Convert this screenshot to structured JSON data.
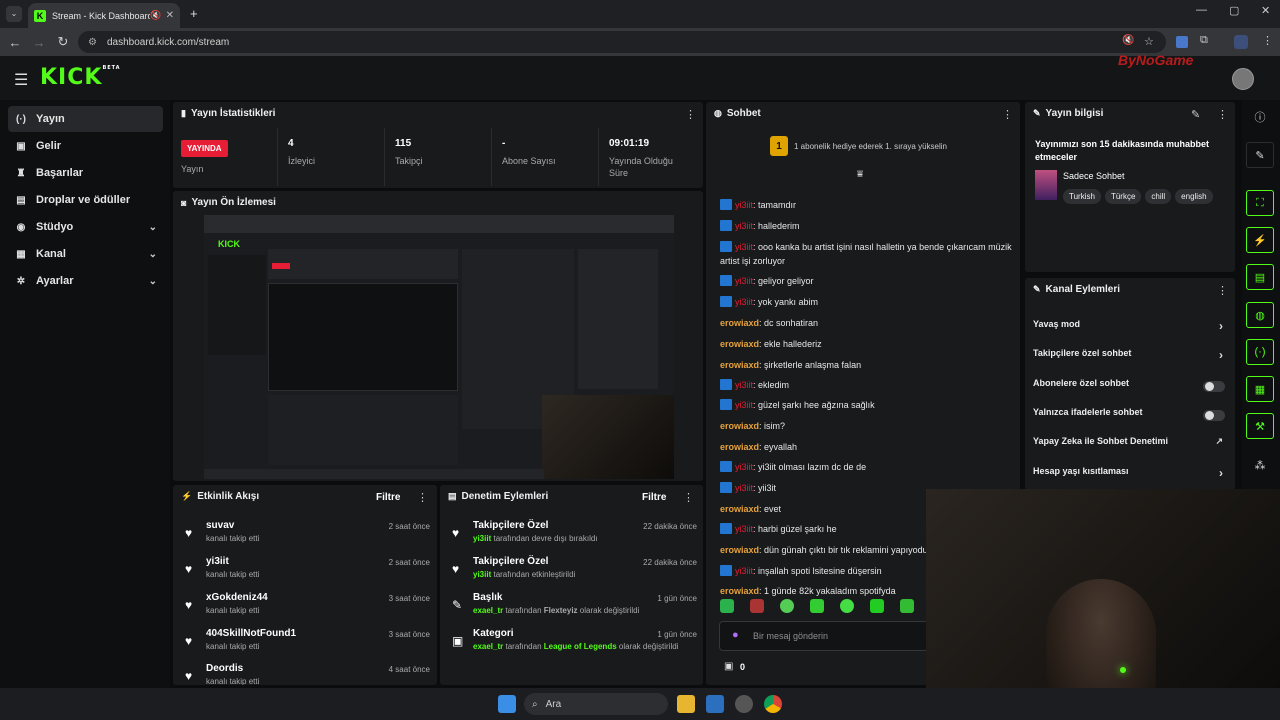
{
  "browser": {
    "tab_title": "Stream - Kick Dashboard",
    "url": "dashboard.kick.com/stream",
    "new_tab": "+"
  },
  "header": {
    "logo": "KICK",
    "logo_badge": "BETA",
    "watermark": "ByNoGame"
  },
  "sidebar": {
    "items": [
      {
        "label": "Yayın",
        "icon": "broadcast-icon"
      },
      {
        "label": "Gelir",
        "icon": "revenue-icon"
      },
      {
        "label": "Başarılar",
        "icon": "trophy-icon"
      },
      {
        "label": "Droplar ve ödüller",
        "icon": "gift-icon"
      },
      {
        "label": "Stüdyo",
        "icon": "studio-icon"
      },
      {
        "label": "Kanal",
        "icon": "channel-icon"
      },
      {
        "label": "Ayarlar",
        "icon": "gear-icon"
      }
    ]
  },
  "stats": {
    "title": "Yayın İstatistikleri",
    "live_badge": "YAYINDA",
    "live_label": "Yayın",
    "viewers_value": "4",
    "viewers_label": "İzleyici",
    "followers_value": "115",
    "followers_label": "Takipçi",
    "subs_value": "-",
    "subs_label": "Abone Sayısı",
    "uptime_value": "09:01:19",
    "uptime_label": "Yayında Olduğu Süre"
  },
  "preview": {
    "title": "Yayın Ön İzlemesi"
  },
  "activity": {
    "title": "Etkinlik Akışı",
    "filter": "Filtre",
    "rows": [
      {
        "name": "suvav",
        "sub": "kanalı takip etti",
        "time": "2 saat önce"
      },
      {
        "name": "yi3iit",
        "sub": "kanalı takip etti",
        "time": "2 saat önce"
      },
      {
        "name": "xGokdeniz44",
        "sub": "kanalı takip etti",
        "time": "3 saat önce"
      },
      {
        "name": "404SkillNotFound1",
        "sub": "kanalı takip etti",
        "time": "3 saat önce"
      },
      {
        "name": "Deordis",
        "sub": "kanalı takip etti",
        "time": "4 saat önce"
      }
    ]
  },
  "moderation": {
    "title": "Denetim Eylemleri",
    "filter": "Filtre",
    "rows": [
      {
        "name": "Takipçilere Özel",
        "user": "yi3iit",
        "mid": "tarafından devre dışı bırakıldı",
        "extra": "",
        "tail": "",
        "time": "22 dakika önce"
      },
      {
        "name": "Takipçilere Özel",
        "user": "yi3iit",
        "mid": "tarafından etkinleştirildi",
        "extra": "",
        "tail": "",
        "time": "22 dakika önce"
      },
      {
        "name": "Başlık",
        "user": "exael_tr",
        "mid": "tarafından",
        "extra": "Flexteyiz",
        "tail": "olarak değiştirildi",
        "time": "1 gün önce"
      },
      {
        "name": "Kategori",
        "user": "exael_tr",
        "mid": "tarafından",
        "extra": "League of Legends",
        "tail": "olarak değiştirildi",
        "time": "1 gün önce"
      }
    ]
  },
  "chat": {
    "title": "Sohbet",
    "gift_number": "1",
    "gift_text": "1 abonelik hediye ederek 1. sıraya yükselin",
    "messages": [
      {
        "user": "yi3iit",
        "text": "tamamdır",
        "badge": true
      },
      {
        "user": "yi3iit",
        "text": "hallederim",
        "badge": true
      },
      {
        "user": "yi3iit",
        "text": "ooo kanka bu artist işini nasıl halletin ya bende çıkarıcam müzik artist işi zorluyor",
        "badge": true
      },
      {
        "user": "yi3iit",
        "text": "geliyor geliyor",
        "badge": true
      },
      {
        "user": "yi3iit",
        "text": "yok yankı abim",
        "badge": true
      },
      {
        "user": "erowiaxd",
        "text": "dc sonhatiran",
        "badge": false
      },
      {
        "user": "erowiaxd",
        "text": "ekle hallederiz",
        "badge": false
      },
      {
        "user": "erowiaxd",
        "text": "şirketlerle anlaşma falan",
        "badge": false
      },
      {
        "user": "yi3iit",
        "text": "ekledim",
        "badge": true
      },
      {
        "user": "yi3iit",
        "text": "güzel şarkı hee ağzına sağlık",
        "badge": true
      },
      {
        "user": "erowiaxd",
        "text": "isim?",
        "badge": false
      },
      {
        "user": "erowiaxd",
        "text": "eyvallah",
        "badge": false
      },
      {
        "user": "yi3iit",
        "text": "yi3iit olması lazım dc de de",
        "badge": true
      },
      {
        "user": "yi3iit",
        "text": "yii3it",
        "badge": true
      },
      {
        "user": "erowiaxd",
        "text": "evet",
        "badge": false
      },
      {
        "user": "yi3iit",
        "text": "harbi güzel şarkı he",
        "badge": true
      },
      {
        "user": "erowiaxd",
        "text": "dün günah çıktı bir tık reklamini yapıyodu",
        "badge": false
      },
      {
        "user": "yi3iit",
        "text": "inşallah spoti lsitesine düşersin",
        "badge": true
      },
      {
        "user": "erowiaxd",
        "text": "1 günde 82k yakaladım spotifyda",
        "badge": false
      }
    ],
    "input_placeholder": "Bir mesaj gönderin",
    "points": "0"
  },
  "stream_info": {
    "title": "Yayın bilgisi",
    "stream_title": "Yayınımızı son 15 dakikasında muhabbet etmeceler",
    "category": "Sadece Sohbet",
    "tags": [
      "Turkish",
      "Türkçe",
      "chill",
      "english"
    ]
  },
  "channel_actions": {
    "title": "Kanal Eylemleri",
    "items": [
      {
        "label": "Yavaş mod",
        "kind": "arrow"
      },
      {
        "label": "Takipçilere özel sohbet",
        "kind": "arrow"
      },
      {
        "label": "Abonelere özel sohbet",
        "kind": "toggle"
      },
      {
        "label": "Yalnızca ifadelerle sohbet",
        "kind": "toggle"
      },
      {
        "label": "Yapay Zeka ile Sohbet Denetimi",
        "kind": "external"
      },
      {
        "label": "Hesap yaşı kısıtlaması",
        "kind": "arrow"
      }
    ]
  },
  "taskbar": {
    "search": "Ara"
  },
  "colors": {
    "kick_green": "#53fc18",
    "live_red": "#e61d35",
    "chat_user_red": "#e61d35",
    "chat_user_orange": "#e8a23b"
  }
}
